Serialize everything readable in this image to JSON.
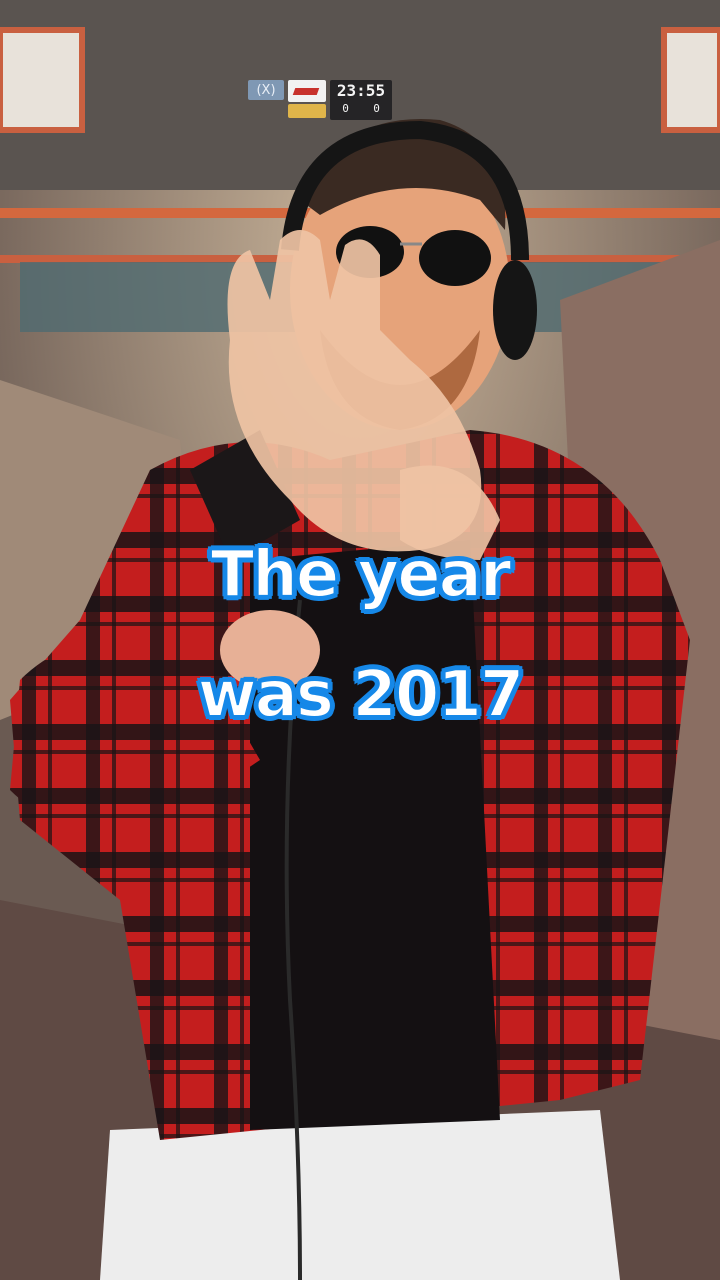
{
  "hud": {
    "team1_logo": "(X)",
    "clock": "23:55",
    "score_left": "0",
    "score_right": "0"
  },
  "caption": {
    "line1": "The year",
    "line2": "was 2017"
  },
  "colors": {
    "caption_outline": "#1688e8",
    "caption_fill": "#ffffff",
    "shirt_red": "#c41e1e",
    "shirt_dark": "#1a1416"
  }
}
